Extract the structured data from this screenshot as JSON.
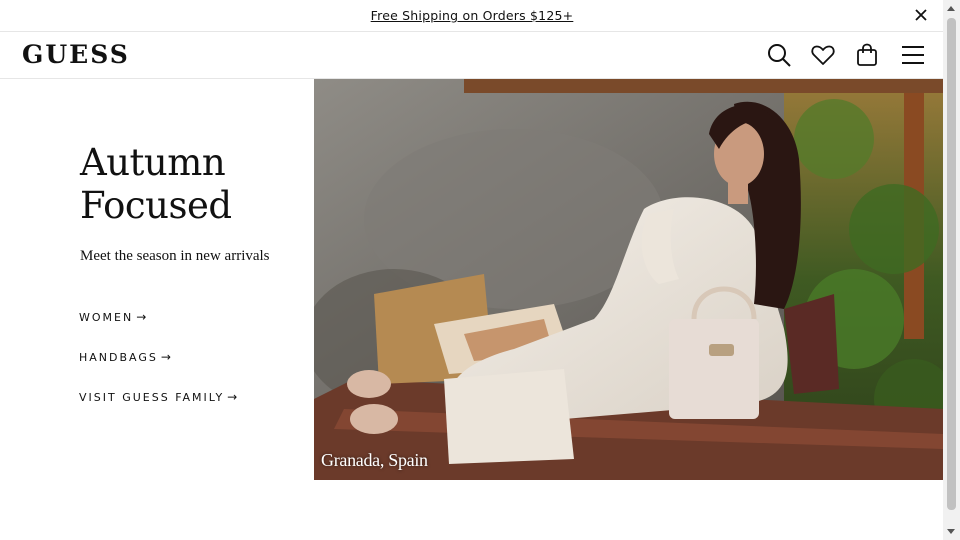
{
  "promo": {
    "text": "Free Shipping on Orders $125+"
  },
  "header": {
    "logo": "GUESS",
    "icons": [
      "search-icon",
      "heart-icon",
      "shopping-bag-icon",
      "menu-icon"
    ]
  },
  "hero": {
    "title_line1": "Autumn",
    "title_line2": "Focused",
    "subtitle": "Meet the season in new arrivals",
    "links": [
      {
        "label": "WOMEN",
        "arrow": "→"
      },
      {
        "label": "HANDBAGS",
        "arrow": "→"
      },
      {
        "label": "VISIT GUESS FAMILY",
        "arrow": "→"
      }
    ],
    "caption": "Granada, Spain"
  }
}
